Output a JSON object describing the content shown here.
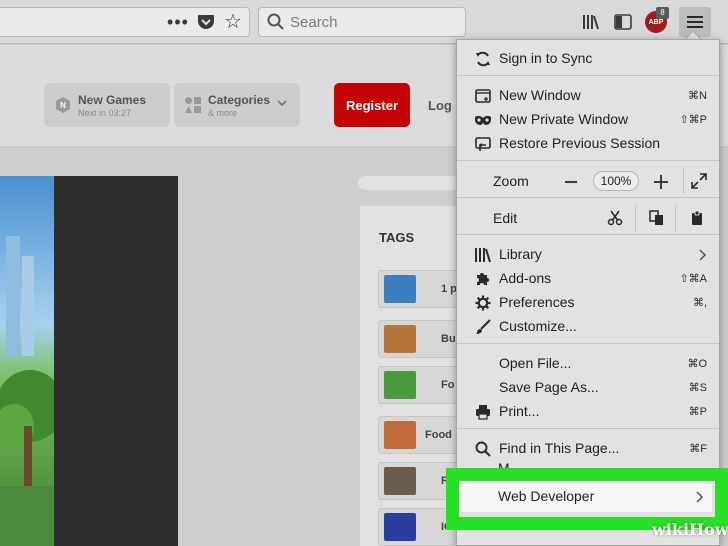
{
  "toolbar": {
    "search_placeholder": "Search",
    "adblock_label": "ABP",
    "adblock_count": "8"
  },
  "site": {
    "new_games_label": "New Games",
    "new_games_sub": "Next in 03:27",
    "categories_label": "Categories",
    "categories_sub": "& more",
    "register_label": "Register",
    "login_label": "Log",
    "tags_title": "TAGS",
    "tags": [
      {
        "label": "1 p",
        "color": "#3b7fc0"
      },
      {
        "label": "Bu",
        "color": "#b7773a"
      },
      {
        "label": "Fo",
        "color": "#4a9a3e"
      },
      {
        "label": "Food",
        "color": "#c06a3a"
      },
      {
        "label": "Re",
        "color": "#6a5a4a"
      },
      {
        "label": "IO",
        "color": "#2a3ea0"
      }
    ]
  },
  "menu": {
    "sign_in": "Sign in to Sync",
    "new_window": {
      "label": "New Window",
      "shortcut": "⌘N"
    },
    "new_private": {
      "label": "New Private Window",
      "shortcut": "⇧⌘P"
    },
    "restore": {
      "label": "Restore Previous Session"
    },
    "zoom_label": "Zoom",
    "zoom_value": "100%",
    "edit_label": "Edit",
    "library": {
      "label": "Library"
    },
    "addons": {
      "label": "Add-ons",
      "shortcut": "⇧⌘A"
    },
    "preferences": {
      "label": "Preferences",
      "shortcut": "⌘,"
    },
    "customize": {
      "label": "Customize..."
    },
    "open_file": {
      "label": "Open File...",
      "shortcut": "⌘O"
    },
    "save_page": {
      "label": "Save Page As...",
      "shortcut": "⌘S"
    },
    "print": {
      "label": "Print...",
      "shortcut": "⌘P"
    },
    "find": {
      "label": "Find in This Page...",
      "shortcut": "⌘F"
    },
    "more_partial": "M",
    "web_developer": {
      "label": "Web Developer"
    }
  },
  "colors": {
    "highlight": "#28e025",
    "register": "#c40404"
  },
  "watermark": "wikiHow"
}
